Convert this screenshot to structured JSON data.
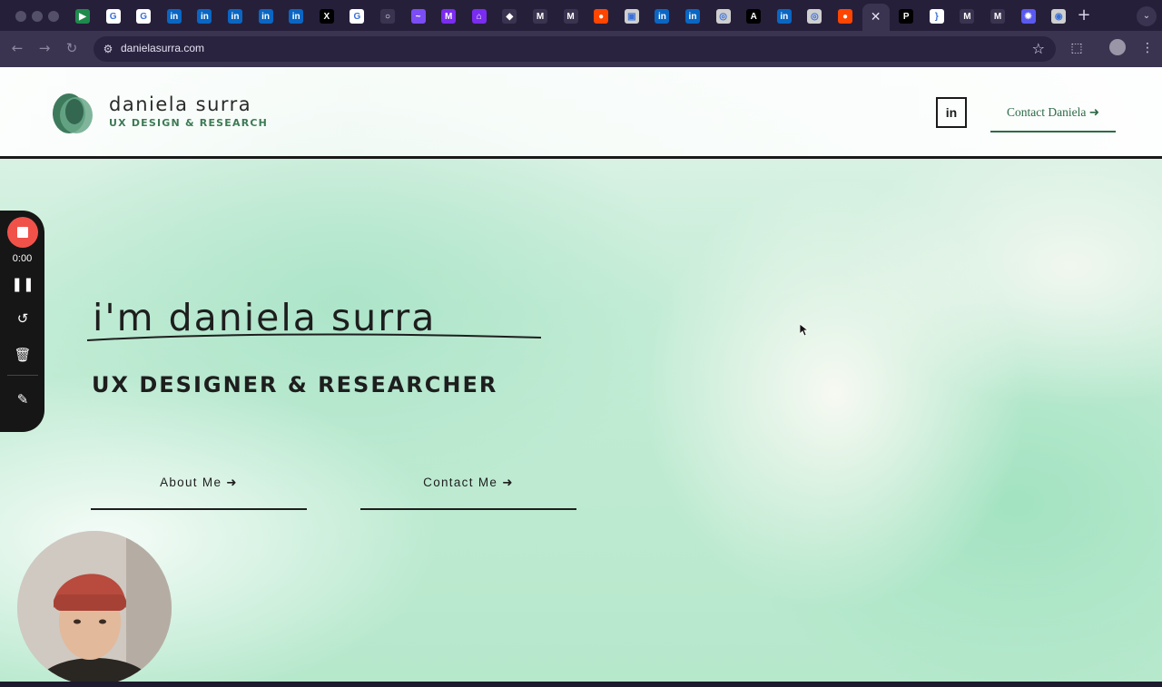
{
  "browser": {
    "url": "danielasurra.com",
    "tabs": [
      {
        "icon": "google-meet-icon",
        "color": "#1f8a4c",
        "glyph": "▶"
      },
      {
        "icon": "google-icon",
        "color": "#ffffff",
        "glyph": "G"
      },
      {
        "icon": "google-icon",
        "color": "#ffffff",
        "glyph": "G"
      },
      {
        "icon": "linkedin-icon",
        "color": "#0a66c2",
        "glyph": "in"
      },
      {
        "icon": "linkedin-icon",
        "color": "#0a66c2",
        "glyph": "in"
      },
      {
        "icon": "linkedin-icon",
        "color": "#0a66c2",
        "glyph": "in"
      },
      {
        "icon": "linkedin-icon",
        "color": "#0a66c2",
        "glyph": "in"
      },
      {
        "icon": "linkedin-icon",
        "color": "#0a66c2",
        "glyph": "in"
      },
      {
        "icon": "x-icon",
        "color": "#000000",
        "glyph": "X"
      },
      {
        "icon": "google-icon",
        "color": "#ffffff",
        "glyph": "G"
      },
      {
        "icon": "ring-icon",
        "color": "#3b3450",
        "glyph": "○"
      },
      {
        "icon": "messenger-icon",
        "color": "#7b4df5",
        "glyph": "~"
      },
      {
        "icon": "app-icon",
        "color": "#7a2cf0",
        "glyph": "M"
      },
      {
        "icon": "app-icon",
        "color": "#7a2cf0",
        "glyph": "⌂"
      },
      {
        "icon": "graduation-icon",
        "color": "#3b3450",
        "glyph": "◆"
      },
      {
        "icon": "gmail-icon",
        "color": "#3b3450",
        "glyph": "M"
      },
      {
        "icon": "gmail-icon",
        "color": "#3b3450",
        "glyph": "M"
      },
      {
        "icon": "reddit-icon",
        "color": "#ff4500",
        "glyph": "●"
      },
      {
        "icon": "image-icon",
        "color": "#cfcfcf",
        "glyph": "▣"
      },
      {
        "icon": "linkedin-icon",
        "color": "#0a66c2",
        "glyph": "in"
      },
      {
        "icon": "linkedin-icon",
        "color": "#0a66c2",
        "glyph": "in"
      },
      {
        "icon": "openai-icon",
        "color": "#cfcfcf",
        "glyph": "◎"
      },
      {
        "icon": "anthropic-icon",
        "color": "#000000",
        "glyph": "A"
      },
      {
        "icon": "linkedin-icon",
        "color": "#0a66c2",
        "glyph": "in"
      },
      {
        "icon": "openai-icon",
        "color": "#cfcfcf",
        "glyph": "◎"
      },
      {
        "icon": "reddit-icon",
        "color": "#ff4500",
        "glyph": "●"
      },
      {
        "icon": "close-icon",
        "color": "",
        "glyph": "✕",
        "active": true
      },
      {
        "icon": "p-icon",
        "color": "#000000",
        "glyph": "P"
      },
      {
        "icon": "bracket-icon",
        "color": "#ffffff",
        "glyph": "}"
      },
      {
        "icon": "gmail-icon",
        "color": "#3b3450",
        "glyph": "M"
      },
      {
        "icon": "gmail-icon",
        "color": "#3b3450",
        "glyph": "M"
      },
      {
        "icon": "gear-icon",
        "color": "#5a5af0",
        "glyph": "✹"
      },
      {
        "icon": "chrome-icon",
        "color": "#cfcfcf",
        "glyph": "◉"
      }
    ]
  },
  "site": {
    "brand_name": "Daniela Surra",
    "brand_tagline": "UX Design & Research",
    "linkedin_label": "in",
    "header_cta": "Contact Daniela ➜",
    "headline": "I'm Daniela Surra",
    "subheadline": "UX Designer & Researcher",
    "buttons": {
      "about": "About Me ➜",
      "contact": "Contact Me ➜"
    }
  },
  "recorder": {
    "time": "0:00"
  }
}
